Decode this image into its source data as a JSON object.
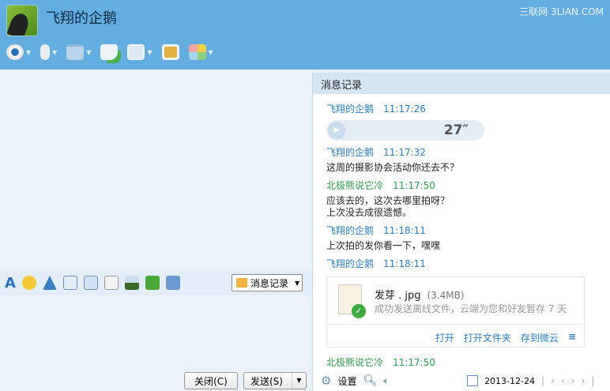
{
  "header": {
    "title": "飞翔的企鹅",
    "watermark": "三联网 3LIAN.COM"
  },
  "toolbar": [
    "video-call",
    "voice-call",
    "send-file",
    "create-discussion",
    "remote-desktop",
    "share-screen",
    "apps"
  ],
  "editor": {
    "history_button": "消息记录",
    "close_button": "关闭(C)",
    "send_button": "发送(S)"
  },
  "history": {
    "title": "消息记录",
    "messages": [
      {
        "sender": "飞翔的企鹅",
        "time": "11:17:26",
        "voice": "27″"
      },
      {
        "sender": "飞翔的企鹅",
        "time": "11:17:32",
        "text": "这周的摄影协会活动你还去不？"
      },
      {
        "sender": "北极熊说它冷",
        "time": "11:17:50",
        "text": "应该去的，这次去哪里拍呀？",
        "text2": "上次没去成很遗憾。"
      },
      {
        "sender": "飞翔的企鹅",
        "time": "11:18:11",
        "text": "上次拍的发你看一下，嘿嘿"
      },
      {
        "sender": "飞翔的企鹅",
        "time": "11:18:11"
      },
      {
        "sender": "北极熊说它冷",
        "time": "11:17:50"
      }
    ],
    "file": {
      "name": "发芽 . jpg",
      "size": "(3.4MB)",
      "desc": "成功发送离线文件，云端为您和好友暂存 7 天",
      "open": "打开",
      "open_folder": "打开文件夹",
      "save_cloud": "存到微云"
    },
    "footer": {
      "settings": "设置",
      "date": "2013-12-24"
    }
  },
  "colors": {
    "header": "#63ade0",
    "sender_self": "#2a7ec0",
    "sender_other": "#2e9c4e"
  }
}
